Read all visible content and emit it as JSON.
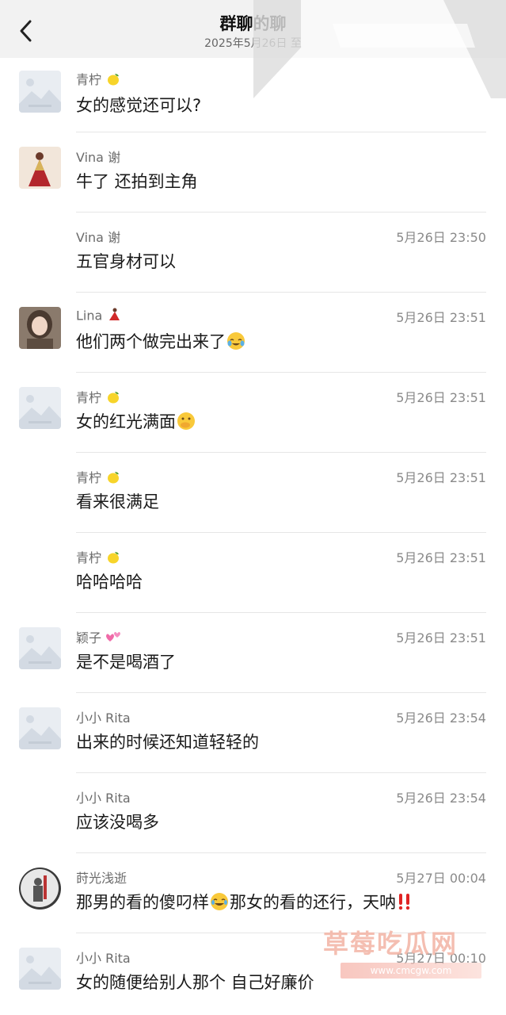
{
  "header": {
    "title": "群聊的聊",
    "subtitle": "2025年5月26日 至"
  },
  "messages": [
    {
      "sender": "青柠",
      "sender_emoji": "lemon",
      "time": "",
      "text": "女的感觉还可以?",
      "avatar": "placeholder-image",
      "text_emoji": ""
    },
    {
      "sender": "Vina 谢",
      "sender_emoji": "",
      "time": "",
      "text": "牛了 还拍到主角",
      "avatar": "woman-red-dress",
      "text_emoji": ""
    },
    {
      "sender": "Vina 谢",
      "sender_emoji": "",
      "time": "5月26日 23:50",
      "text": "五官身材可以",
      "avatar": "",
      "text_emoji": ""
    },
    {
      "sender": "Lina",
      "sender_emoji": "dancer",
      "time": "5月26日 23:51",
      "text": "他们两个做完出来了",
      "avatar": "woman-portrait",
      "text_emoji": "crying-laughing"
    },
    {
      "sender": "青柠",
      "sender_emoji": "lemon",
      "time": "5月26日 23:51",
      "text": "女的红光满面",
      "avatar": "placeholder-image",
      "text_emoji": "thinking-hand-mouth"
    },
    {
      "sender": "青柠",
      "sender_emoji": "lemon",
      "time": "5月26日 23:51",
      "text": "看来很满足",
      "avatar": "",
      "text_emoji": ""
    },
    {
      "sender": "青柠",
      "sender_emoji": "lemon",
      "time": "5月26日 23:51",
      "text": "哈哈哈哈",
      "avatar": "",
      "text_emoji": ""
    },
    {
      "sender": "颖子",
      "sender_emoji": "two-hearts",
      "time": "5月26日 23:51",
      "text": "是不是喝酒了",
      "avatar": "placeholder-image",
      "text_emoji": ""
    },
    {
      "sender": "小小 Rita",
      "sender_emoji": "",
      "time": "5月26日 23:54",
      "text": "出来的时候还知道轻轻的",
      "avatar": "placeholder-image",
      "text_emoji": ""
    },
    {
      "sender": "小小 Rita",
      "sender_emoji": "",
      "time": "5月26日 23:54",
      "text": "应该没喝多",
      "avatar": "",
      "text_emoji": ""
    },
    {
      "sender": "莳光浅逝",
      "sender_emoji": "",
      "time": "5月27日 00:04",
      "text": "那男的看的傻叼样",
      "avatar": "dark-figure",
      "text_emoji": "laughing-tears",
      "text_after": "那女的看的还行，天呐",
      "text_emoji_after": "double-exclamation"
    },
    {
      "sender": "小小 Rita",
      "sender_emoji": "",
      "time": "5月27日 00:10",
      "text": "女的随便给别人那个 自己好廉价",
      "avatar": "placeholder-image",
      "text_emoji": ""
    }
  ],
  "watermark": {
    "brand": "草莓吃瓜网",
    "url": "www.cmcgw.com"
  },
  "colors": {
    "header_bg": "#f2f2f2",
    "divider": "#e6e6e6",
    "time_text": "#8a8a8a",
    "watermark": "#f3b3a4"
  }
}
